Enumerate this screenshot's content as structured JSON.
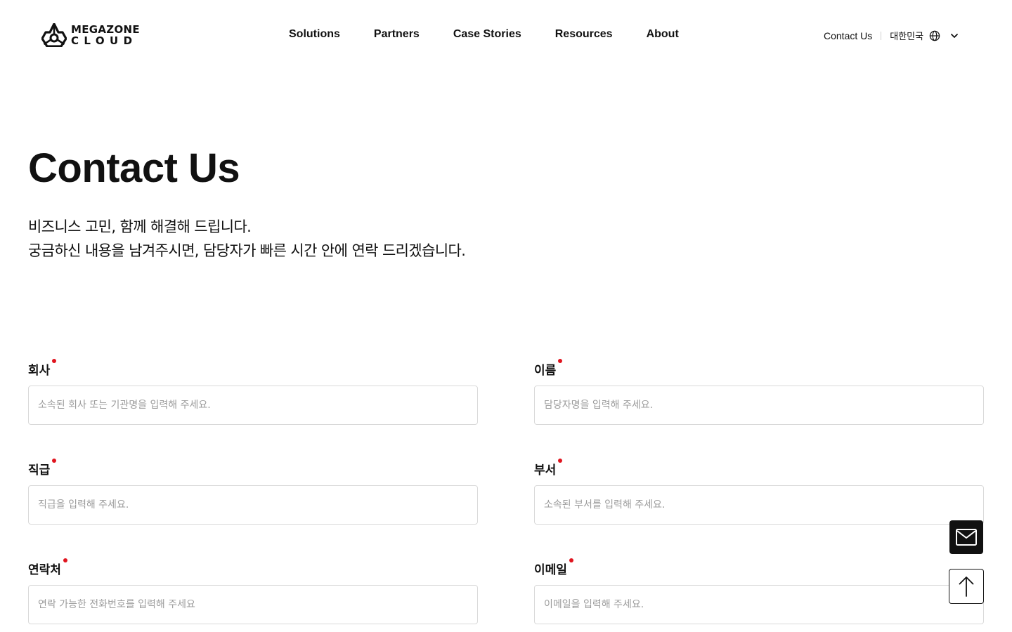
{
  "header": {
    "logo": {
      "line1": "MEGAZONE",
      "line2": "CLOUD"
    },
    "nav": [
      {
        "label": "Solutions"
      },
      {
        "label": "Partners"
      },
      {
        "label": "Case Stories"
      },
      {
        "label": "Resources"
      },
      {
        "label": "About"
      }
    ],
    "contact_label": "Contact Us",
    "language_label": "대한민국",
    "icons": {
      "language": "globe-icon",
      "dropdown": "chevron-down-icon"
    }
  },
  "hero": {
    "title": "Contact Us",
    "subtitle_line1": "비즈니스 고민, 함께 해결해 드립니다.",
    "subtitle_line2": "궁금하신 내용을 남겨주시면, 담당자가 빠른 시간 안에 연락 드리겠습니다."
  },
  "form": {
    "company": {
      "label": "회사",
      "placeholder": "소속된 회사 또는 기관명을 입력해 주세요.",
      "value": ""
    },
    "name": {
      "label": "이름",
      "placeholder": "담당자명을 입력해 주세요.",
      "value": ""
    },
    "position": {
      "label": "직급",
      "placeholder": "직급을 입력해 주세요.",
      "value": ""
    },
    "department": {
      "label": "부서",
      "placeholder": "소속된 부서를 입력해 주세요.",
      "value": ""
    },
    "phone": {
      "label": "연락처",
      "placeholder": "연락 가능한 전화번호를 입력해 주세요",
      "value": ""
    },
    "email": {
      "label": "이메일",
      "placeholder": "이메일을 입력해 주세요.",
      "value": ""
    }
  },
  "floating": {
    "mail_icon": "mail-icon",
    "top_icon": "arrow-up-icon"
  },
  "colors": {
    "required_dot": "#e0141e",
    "text": "#111111",
    "border": "#d9d9d9",
    "placeholder": "#9b9b9b"
  }
}
